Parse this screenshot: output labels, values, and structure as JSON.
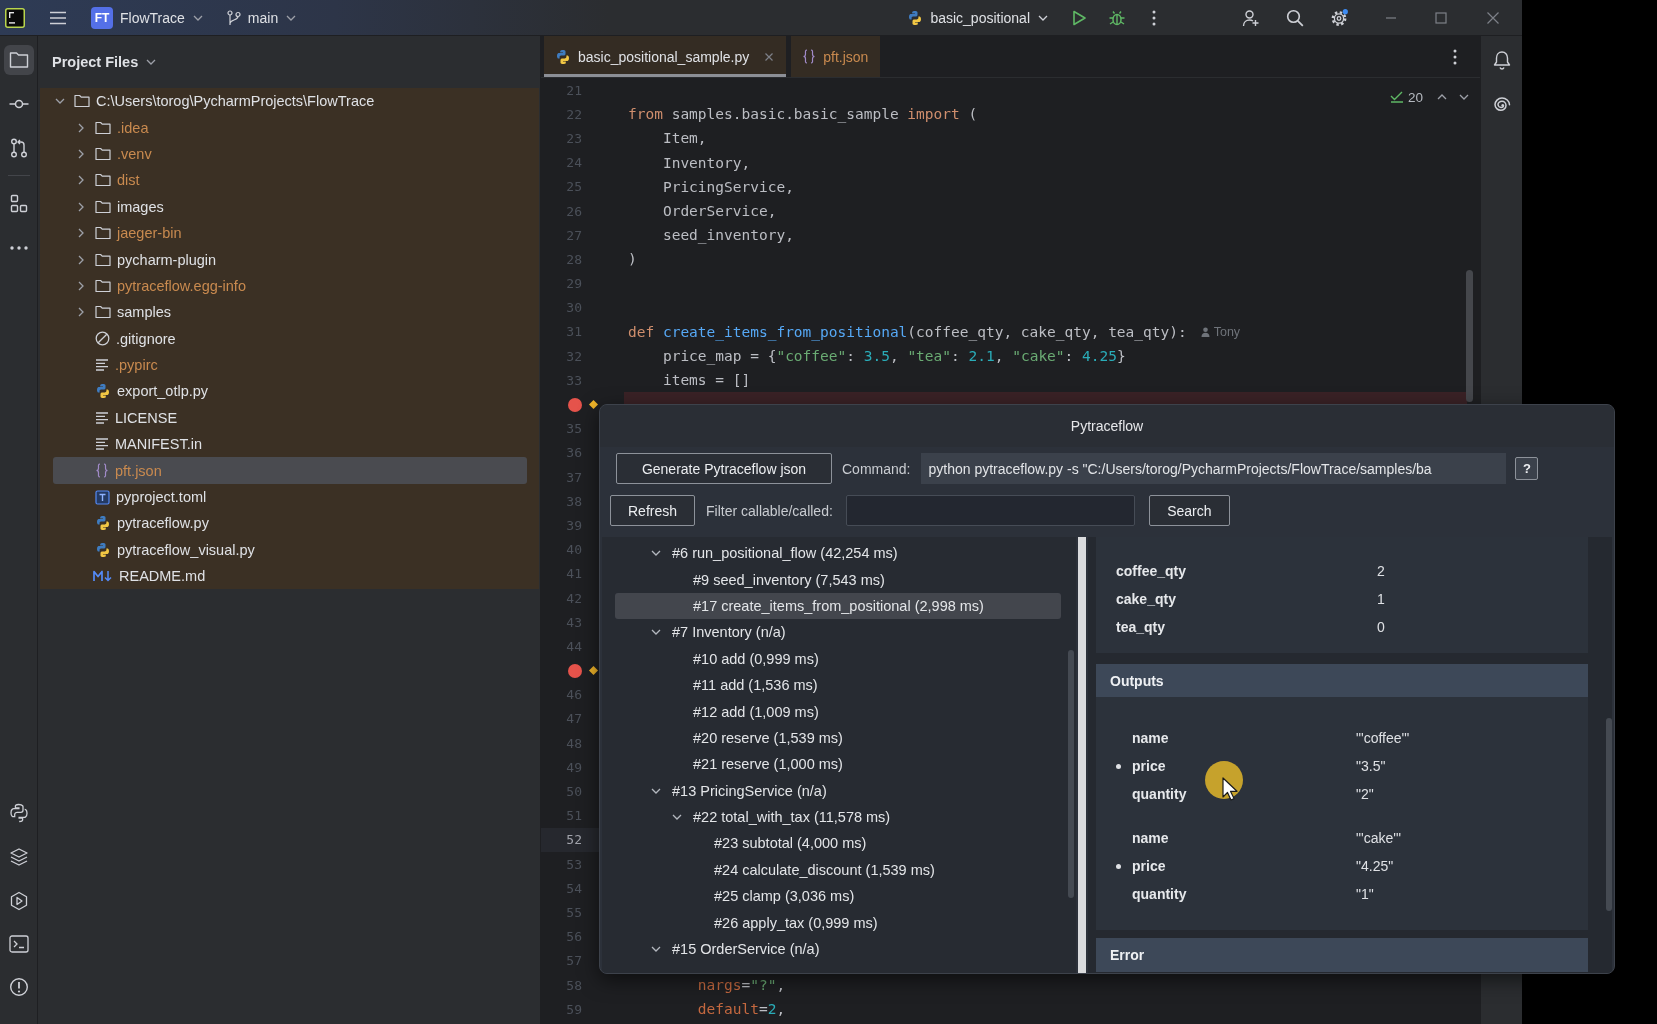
{
  "title_bar": {
    "project_initials": "FT",
    "project_name": "FlowTrace",
    "branch": "main",
    "run_configuration": "basic_positional"
  },
  "left_toolbar": [
    {
      "selected": true
    },
    {
      "selected": false
    },
    {
      "selected": false
    },
    {
      "selected": false
    }
  ],
  "project_panel": {
    "title": "Project Files",
    "tree": [
      {
        "name": "C:\\Users\\torog\\PycharmProjects\\FlowTrace",
        "kind": "folder",
        "expanded": true,
        "ignored": false,
        "selected": false,
        "children": [
          {
            "name": ".idea",
            "kind": "folder",
            "expanded": false,
            "ignored": true,
            "selected": false
          },
          {
            "name": ".venv",
            "kind": "folder",
            "expanded": false,
            "ignored": true,
            "selected": false
          },
          {
            "name": "dist",
            "kind": "folder",
            "expanded": false,
            "ignored": true,
            "selected": false
          },
          {
            "name": "images",
            "kind": "folder",
            "expanded": false,
            "ignored": false,
            "selected": false
          },
          {
            "name": "jaeger-bin",
            "kind": "folder",
            "expanded": false,
            "ignored": true,
            "selected": false
          },
          {
            "name": "pycharm-plugin",
            "kind": "folder",
            "expanded": false,
            "ignored": false,
            "selected": false
          },
          {
            "name": "pytraceflow.egg-info",
            "kind": "folder",
            "expanded": false,
            "ignored": true,
            "selected": false
          },
          {
            "name": "samples",
            "kind": "folder",
            "expanded": false,
            "ignored": false,
            "selected": false
          },
          {
            "name": ".gitignore",
            "kind": "gitignore",
            "ignored": false,
            "selected": false
          },
          {
            "name": ".pypirc",
            "kind": "text",
            "ignored": true,
            "selected": false
          },
          {
            "name": "export_otlp.py",
            "kind": "python",
            "ignored": false,
            "selected": false
          },
          {
            "name": "LICENSE",
            "kind": "text",
            "ignored": false,
            "selected": false
          },
          {
            "name": "MANIFEST.in",
            "kind": "text",
            "ignored": false,
            "selected": false
          },
          {
            "name": "pft.json",
            "kind": "json",
            "ignored": true,
            "selected": true
          },
          {
            "name": "pyproject.toml",
            "kind": "toml",
            "ignored": false,
            "selected": false
          },
          {
            "name": "pytraceflow.py",
            "kind": "python",
            "ignored": false,
            "selected": false
          },
          {
            "name": "pytraceflow_visual.py",
            "kind": "python",
            "ignored": false,
            "selected": false
          },
          {
            "name": "README.md",
            "kind": "markdown",
            "ignored": false,
            "selected": false
          }
        ]
      }
    ]
  },
  "editor": {
    "tabs": [
      {
        "name": "basic_positional_sample.py",
        "kind": "python",
        "selected": true,
        "ignored": false
      },
      {
        "name": "pft.json",
        "kind": "json",
        "selected": false,
        "ignored": true
      }
    ],
    "inspection_count": "20",
    "lines": [
      {
        "number": "21",
        "breakpoint": false,
        "current": false
      },
      {
        "number": "22",
        "breakpoint": false,
        "current": false,
        "tokens": [
          {
            "text": "from",
            "kind": "keyword"
          },
          {
            "text": " samples.basic.basic_sample ",
            "kind": "plain"
          },
          {
            "text": "import",
            "kind": "keyword"
          },
          {
            "text": " (",
            "kind": "plain"
          }
        ]
      },
      {
        "number": "23",
        "breakpoint": false,
        "current": false,
        "tokens": [
          {
            "text": "    Item,",
            "kind": "plain"
          }
        ]
      },
      {
        "number": "24",
        "breakpoint": false,
        "current": false,
        "tokens": [
          {
            "text": "    Inventory,",
            "kind": "plain"
          }
        ]
      },
      {
        "number": "25",
        "breakpoint": false,
        "current": false,
        "tokens": [
          {
            "text": "    PricingService,",
            "kind": "plain"
          }
        ]
      },
      {
        "number": "26",
        "breakpoint": false,
        "current": false,
        "tokens": [
          {
            "text": "    OrderService,",
            "kind": "plain"
          }
        ]
      },
      {
        "number": "27",
        "breakpoint": false,
        "current": false,
        "tokens": [
          {
            "text": "    seed_inventory,",
            "kind": "plain"
          }
        ]
      },
      {
        "number": "28",
        "breakpoint": false,
        "current": false,
        "tokens": [
          {
            "text": ")",
            "kind": "plain"
          }
        ]
      },
      {
        "number": "29",
        "breakpoint": false,
        "current": false
      },
      {
        "number": "30",
        "breakpoint": false,
        "current": false
      },
      {
        "number": "31",
        "breakpoint": false,
        "current": false,
        "tokens": [
          {
            "text": "def ",
            "kind": "keyword"
          },
          {
            "text": "create_items_from_positional",
            "kind": "function"
          },
          {
            "text": "(coffee_qty, cake_qty, tea_qty):",
            "kind": "plain"
          }
        ],
        "author": "Tony"
      },
      {
        "number": "32",
        "breakpoint": false,
        "current": false,
        "tokens": [
          {
            "text": "    price_map = {",
            "kind": "plain"
          },
          {
            "text": "\"coffee\"",
            "kind": "string"
          },
          {
            "text": ": ",
            "kind": "plain"
          },
          {
            "text": "3.5",
            "kind": "number"
          },
          {
            "text": ", ",
            "kind": "plain"
          },
          {
            "text": "\"tea\"",
            "kind": "string"
          },
          {
            "text": ": ",
            "kind": "plain"
          },
          {
            "text": "2.1",
            "kind": "number"
          },
          {
            "text": ", ",
            "kind": "plain"
          },
          {
            "text": "\"cake\"",
            "kind": "string"
          },
          {
            "text": ": ",
            "kind": "plain"
          },
          {
            "text": "4.25",
            "kind": "number"
          },
          {
            "text": "}",
            "kind": "plain"
          }
        ]
      },
      {
        "number": "33",
        "breakpoint": false,
        "current": false,
        "tokens": [
          {
            "text": "    items = []",
            "kind": "plain"
          }
        ]
      },
      {
        "breakpoint": true,
        "current": false
      },
      {
        "number": "35",
        "breakpoint": false,
        "current": false
      },
      {
        "number": "36",
        "breakpoint": false,
        "current": false
      },
      {
        "number": "37",
        "breakpoint": false,
        "current": false
      },
      {
        "number": "38",
        "breakpoint": false,
        "current": false
      },
      {
        "number": "39",
        "breakpoint": false,
        "current": false
      },
      {
        "number": "40",
        "breakpoint": false,
        "current": false
      },
      {
        "number": "41",
        "breakpoint": false,
        "current": false
      },
      {
        "number": "42",
        "breakpoint": false,
        "current": false
      },
      {
        "number": "43",
        "breakpoint": false,
        "current": false
      },
      {
        "number": "44",
        "breakpoint": false,
        "current": false
      },
      {
        "breakpoint": true,
        "current": false
      },
      {
        "number": "46",
        "breakpoint": false,
        "current": false
      },
      {
        "number": "47",
        "breakpoint": false,
        "current": false
      },
      {
        "number": "48",
        "breakpoint": false,
        "current": false
      },
      {
        "number": "49",
        "breakpoint": false,
        "current": false
      },
      {
        "number": "50",
        "breakpoint": false,
        "current": false
      },
      {
        "number": "51",
        "breakpoint": false,
        "current": false
      },
      {
        "number": "52",
        "breakpoint": false,
        "current": true
      },
      {
        "number": "53",
        "breakpoint": false,
        "current": false
      },
      {
        "number": "54",
        "breakpoint": false,
        "current": false
      },
      {
        "number": "55",
        "breakpoint": false,
        "current": false
      },
      {
        "number": "56",
        "breakpoint": false,
        "current": false
      },
      {
        "number": "57",
        "breakpoint": false,
        "current": false
      },
      {
        "number": "58",
        "breakpoint": false,
        "current": false,
        "tokens": [
          {
            "text": "        nargs",
            "kind": "param"
          },
          {
            "text": "=",
            "kind": "plain"
          },
          {
            "text": "\"?\"",
            "kind": "string"
          },
          {
            "text": ",",
            "kind": "plain"
          }
        ]
      },
      {
        "number": "59",
        "breakpoint": false,
        "current": false,
        "tokens": [
          {
            "text": "        default",
            "kind": "param"
          },
          {
            "text": "=",
            "kind": "plain"
          },
          {
            "text": "2",
            "kind": "number"
          },
          {
            "text": ",",
            "kind": "plain"
          }
        ]
      }
    ]
  },
  "pytraceflow": {
    "title": "Pytraceflow",
    "generate_button": "Generate Pytraceflow json",
    "command_label": "Command:",
    "command": "python pytraceflow.py -s \"C:/Users/torog/PycharmProjects/FlowTrace/samples/ba",
    "help_button": "?",
    "refresh_button": "Refresh",
    "filter_label": "Filter callable/called:",
    "search_button": "Search",
    "call_tree": [
      {
        "label": "#6 run_positional_flow (42,254 ms)",
        "expanded": true,
        "selected": false,
        "children": [
          {
            "label": "#9 seed_inventory (7,543 ms)",
            "selected": false
          },
          {
            "label": "#17 create_items_from_positional (2,998 ms)",
            "selected": true
          }
        ]
      },
      {
        "label": "#7 Inventory (n/a)",
        "expanded": true,
        "selected": false,
        "children": [
          {
            "label": "#10 add (0,999 ms)",
            "selected": false
          },
          {
            "label": "#11 add (1,536 ms)",
            "selected": false
          },
          {
            "label": "#12 add (1,009 ms)",
            "selected": false
          },
          {
            "label": "#20 reserve (1,539 ms)",
            "selected": false
          },
          {
            "label": "#21 reserve (1,000 ms)",
            "selected": false
          }
        ]
      },
      {
        "label": "#13 PricingService (n/a)",
        "expanded": true,
        "selected": false,
        "children": [
          {
            "label": "#22 total_with_tax (11,578 ms)",
            "expanded": true,
            "selected": false,
            "children": [
              {
                "label": "#23 subtotal (4,000 ms)",
                "selected": false
              },
              {
                "label": "#24 calculate_discount (1,539 ms)",
                "selected": false
              },
              {
                "label": "#25 clamp (3,036 ms)",
                "selected": false
              },
              {
                "label": "#26 apply_tax (0,999 ms)",
                "selected": false
              }
            ]
          }
        ]
      },
      {
        "label": "#15 OrderService (n/a)",
        "expanded": true,
        "selected": false
      }
    ],
    "inputs": [
      {
        "name": "coffee_qty",
        "value": "2"
      },
      {
        "name": "cake_qty",
        "value": "1"
      },
      {
        "name": "tea_qty",
        "value": "0"
      }
    ],
    "outputs": {
      "title": "Outputs",
      "items": [
        {
          "fields": [
            {
              "name": "name",
              "value": "\"'coffee'\"",
              "marked": false
            },
            {
              "name": "price",
              "value": "\"3.5\"",
              "marked": true
            },
            {
              "name": "quantity",
              "value": "\"2\"",
              "marked": false
            }
          ]
        },
        {
          "fields": [
            {
              "name": "name",
              "value": "\"'cake'\"",
              "marked": false
            },
            {
              "name": "price",
              "value": "\"4.25\"",
              "marked": true
            },
            {
              "name": "quantity",
              "value": "\"1\"",
              "marked": false
            }
          ]
        }
      ]
    },
    "error": {
      "title": "Error"
    }
  }
}
